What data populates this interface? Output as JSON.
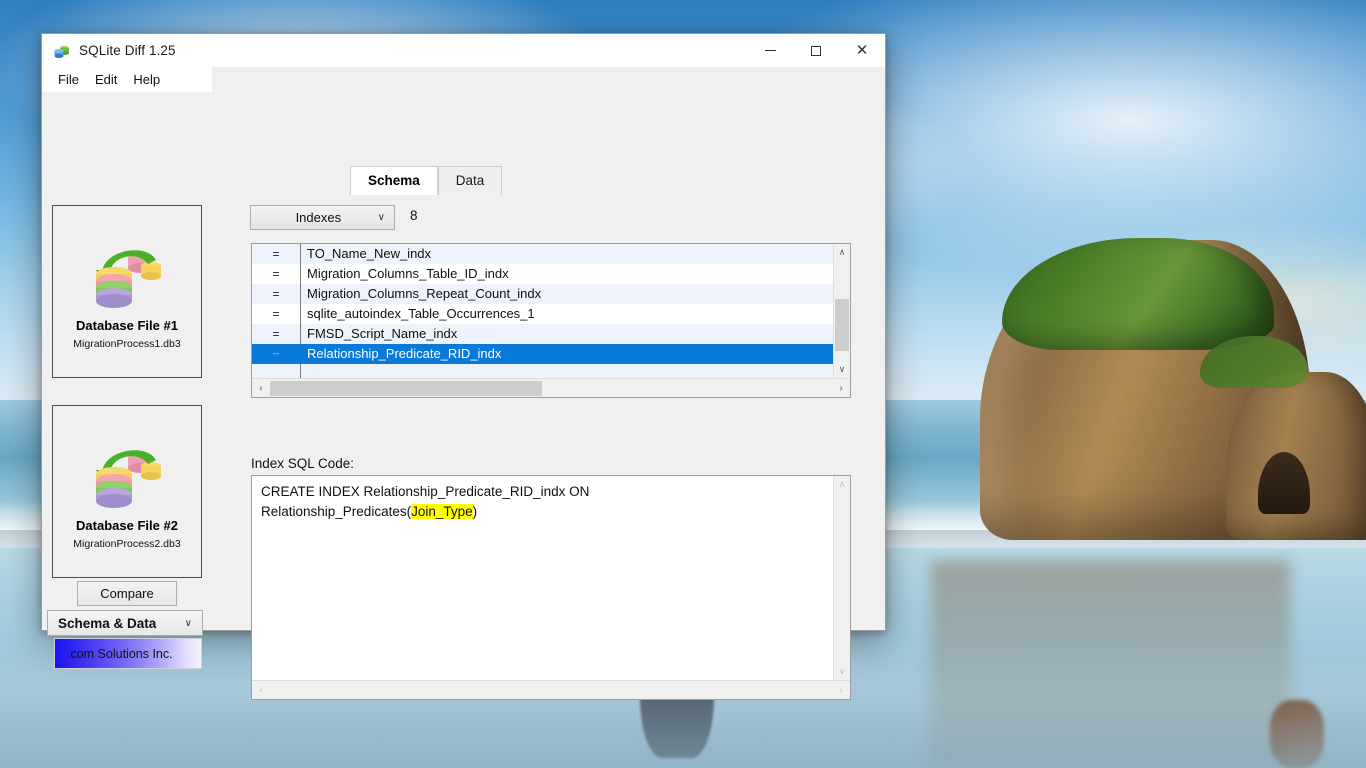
{
  "desktop": {
    "wallpaper_description": "beach-rock-formation-photo"
  },
  "window": {
    "title": "SQLite Diff 1.25",
    "app_icon": "sqlite-diff-icon",
    "controls": {
      "minimize": "—",
      "maximize": "□",
      "close": "✕"
    },
    "menu": [
      {
        "label": "File"
      },
      {
        "label": "Edit"
      },
      {
        "label": "Help"
      }
    ]
  },
  "tabs": [
    {
      "label": "Schema",
      "active": true
    },
    {
      "label": "Data",
      "active": false
    }
  ],
  "sidebar": {
    "db1": {
      "title": "Database File #1",
      "file": "MigrationProcess1.db3",
      "icon": "database-migration-icon"
    },
    "db2": {
      "title": "Database File #2",
      "file": "MigrationProcess2.db3",
      "icon": "database-migration-icon"
    },
    "compare_label": "Compare",
    "compare_mode": {
      "value": "Schema & Data",
      "arrow": "∨"
    },
    "brand": ".com Solutions Inc."
  },
  "main": {
    "object_type": {
      "value": "Indexes",
      "arrow": "∨"
    },
    "object_count": "8",
    "list": {
      "rows": [
        {
          "symbol": "=",
          "name": "TO_Name_New_indx",
          "selected": false
        },
        {
          "symbol": "=",
          "name": "Migration_Columns_Table_ID_indx",
          "selected": false
        },
        {
          "symbol": "=",
          "name": "Migration_Columns_Repeat_Count_indx",
          "selected": false
        },
        {
          "symbol": "=",
          "name": "sqlite_autoindex_Table_Occurrences_1",
          "selected": false
        },
        {
          "symbol": "=",
          "name": "FMSD_Script_Name_indx",
          "selected": false
        },
        {
          "symbol": "~",
          "name": "Relationship_Predicate_RID_indx",
          "selected": true
        }
      ],
      "scroll_up": "∧",
      "scroll_down": "∨",
      "scroll_left": "‹",
      "scroll_right": "›"
    },
    "sql": {
      "label": "Index SQL Code:",
      "line1": "CREATE INDEX Relationship_Predicate_RID_indx ON",
      "line2_prefix": "Relationship_Predicates(",
      "line2_highlight": "Join_Type",
      "line2_suffix": ")",
      "scroll_up": "∧",
      "scroll_down": "∨",
      "scroll_left": "‹",
      "scroll_right": "›"
    }
  },
  "colors": {
    "selection": "#0a7ada",
    "alt_row": "#eef2fa",
    "highlight": "#ffff00",
    "window_bg": "#f0f0f0"
  }
}
